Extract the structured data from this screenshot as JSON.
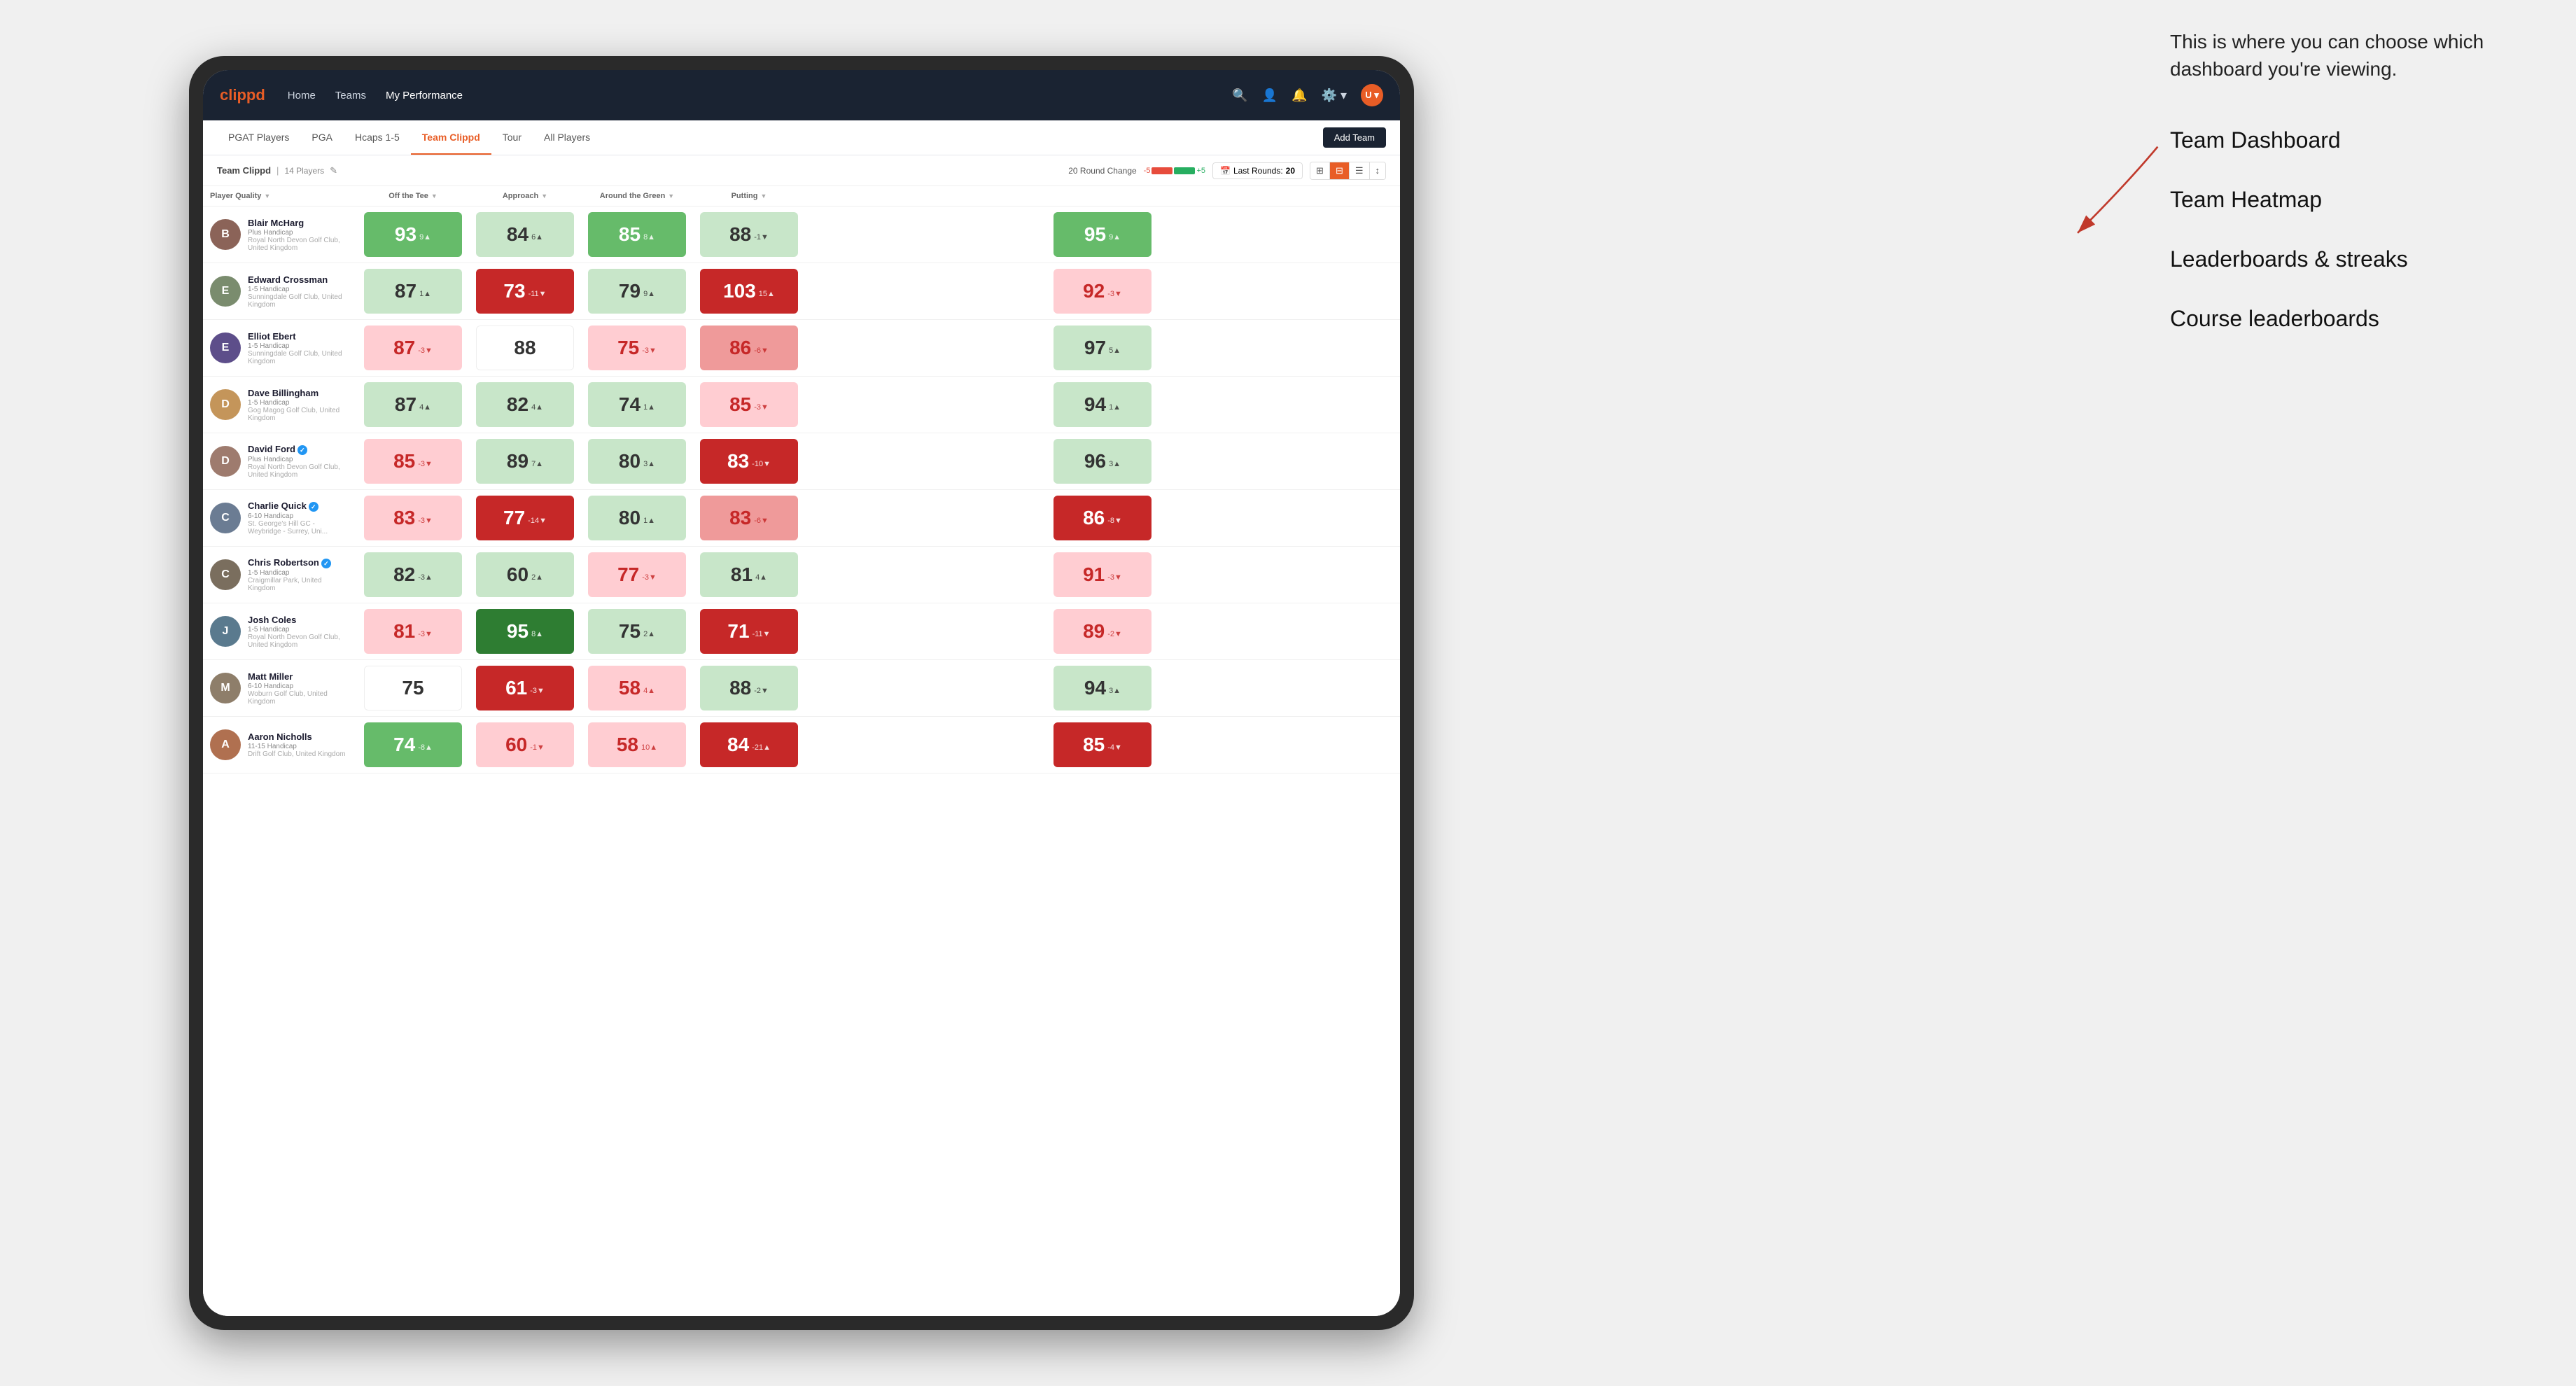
{
  "annotation": {
    "intro_text": "This is where you can choose which dashboard you're viewing.",
    "items": [
      "Team Dashboard",
      "Team Heatmap",
      "Leaderboards & streaks",
      "Course leaderboards"
    ]
  },
  "nav": {
    "logo": "clippd",
    "links": [
      {
        "label": "Home",
        "active": false
      },
      {
        "label": "Teams",
        "active": false
      },
      {
        "label": "My Performance",
        "active": true
      }
    ],
    "icons": [
      "search",
      "user",
      "bell",
      "settings",
      "avatar"
    ]
  },
  "tabs": [
    {
      "label": "PGAT Players",
      "active": false
    },
    {
      "label": "PGA",
      "active": false
    },
    {
      "label": "Hcaps 1-5",
      "active": false
    },
    {
      "label": "Team Clippd",
      "active": true
    },
    {
      "label": "Tour",
      "active": false
    },
    {
      "label": "All Players",
      "active": false
    }
  ],
  "add_team_label": "Add Team",
  "sub_header": {
    "team_name": "Team Clippd",
    "player_count": "14 Players",
    "round_change_label": "20 Round Change",
    "neg_value": "-5",
    "pos_value": "+5",
    "last_rounds_label": "Last Rounds:",
    "last_rounds_value": "20"
  },
  "table": {
    "columns": [
      {
        "key": "player",
        "label": "Player Quality"
      },
      {
        "key": "off_tee",
        "label": "Off the Tee"
      },
      {
        "key": "approach",
        "label": "Approach"
      },
      {
        "key": "around_green",
        "label": "Around the Green"
      },
      {
        "key": "putting",
        "label": "Putting"
      }
    ],
    "players": [
      {
        "name": "Blair McHarg",
        "handicap": "Plus Handicap",
        "club": "Royal North Devon Golf Club, United Kingdom",
        "avatar_letter": "B",
        "avatar_color": "#8b6358",
        "scores": [
          {
            "value": "93",
            "change": "9▲",
            "bg": "green-mid"
          },
          {
            "value": "84",
            "change": "6▲",
            "bg": "green-light"
          },
          {
            "value": "85",
            "change": "8▲",
            "bg": "green-mid"
          },
          {
            "value": "88",
            "change": "-1▼",
            "bg": "green-light"
          },
          {
            "value": "95",
            "change": "9▲",
            "bg": "green-mid"
          }
        ]
      },
      {
        "name": "Edward Crossman",
        "handicap": "1-5 Handicap",
        "club": "Sunningdale Golf Club, United Kingdom",
        "avatar_letter": "E",
        "avatar_color": "#7a8c6e",
        "scores": [
          {
            "value": "87",
            "change": "1▲",
            "bg": "green-light"
          },
          {
            "value": "73",
            "change": "-11▼",
            "bg": "red-dark"
          },
          {
            "value": "79",
            "change": "9▲",
            "bg": "green-light"
          },
          {
            "value": "103",
            "change": "15▲",
            "bg": "red-dark"
          },
          {
            "value": "92",
            "change": "-3▼",
            "bg": "red-light"
          }
        ]
      },
      {
        "name": "Elliot Ebert",
        "handicap": "1-5 Handicap",
        "club": "Sunningdale Golf Club, United Kingdom",
        "avatar_letter": "E",
        "avatar_color": "#5d4e8a",
        "scores": [
          {
            "value": "87",
            "change": "-3▼",
            "bg": "red-light"
          },
          {
            "value": "88",
            "change": "",
            "bg": "white"
          },
          {
            "value": "75",
            "change": "-3▼",
            "bg": "red-light"
          },
          {
            "value": "86",
            "change": "-6▼",
            "bg": "red-mid"
          },
          {
            "value": "97",
            "change": "5▲",
            "bg": "green-light"
          }
        ]
      },
      {
        "name": "Dave Billingham",
        "handicap": "1-5 Handicap",
        "club": "Gog Magog Golf Club, United Kingdom",
        "avatar_letter": "D",
        "avatar_color": "#c4955a",
        "scores": [
          {
            "value": "87",
            "change": "4▲",
            "bg": "green-light"
          },
          {
            "value": "82",
            "change": "4▲",
            "bg": "green-light"
          },
          {
            "value": "74",
            "change": "1▲",
            "bg": "green-light"
          },
          {
            "value": "85",
            "change": "-3▼",
            "bg": "red-light"
          },
          {
            "value": "94",
            "change": "1▲",
            "bg": "green-light"
          }
        ]
      },
      {
        "name": "David Ford",
        "handicap": "Plus Handicap",
        "club": "Royal North Devon Golf Club, United Kingdom",
        "avatar_letter": "D",
        "avatar_color": "#9e7b6e",
        "verified": true,
        "scores": [
          {
            "value": "85",
            "change": "-3▼",
            "bg": "red-light"
          },
          {
            "value": "89",
            "change": "7▲",
            "bg": "green-light"
          },
          {
            "value": "80",
            "change": "3▲",
            "bg": "green-light"
          },
          {
            "value": "83",
            "change": "-10▼",
            "bg": "red-dark"
          },
          {
            "value": "96",
            "change": "3▲",
            "bg": "green-light"
          }
        ]
      },
      {
        "name": "Charlie Quick",
        "handicap": "6-10 Handicap",
        "club": "St. George's Hill GC - Weybridge - Surrey, Uni...",
        "avatar_letter": "C",
        "avatar_color": "#6b7c93",
        "verified": true,
        "scores": [
          {
            "value": "83",
            "change": "-3▼",
            "bg": "red-light"
          },
          {
            "value": "77",
            "change": "-14▼",
            "bg": "red-dark"
          },
          {
            "value": "80",
            "change": "1▲",
            "bg": "green-light"
          },
          {
            "value": "83",
            "change": "-6▼",
            "bg": "red-mid"
          },
          {
            "value": "86",
            "change": "-8▼",
            "bg": "red-dark"
          }
        ]
      },
      {
        "name": "Chris Robertson",
        "handicap": "1-5 Handicap",
        "club": "Craigmillar Park, United Kingdom",
        "avatar_letter": "C",
        "avatar_color": "#7a6e5e",
        "verified": true,
        "scores": [
          {
            "value": "82",
            "change": "-3▲",
            "bg": "green-light"
          },
          {
            "value": "60",
            "change": "2▲",
            "bg": "green-light"
          },
          {
            "value": "77",
            "change": "-3▼",
            "bg": "red-light"
          },
          {
            "value": "81",
            "change": "4▲",
            "bg": "green-light"
          },
          {
            "value": "91",
            "change": "-3▼",
            "bg": "red-light"
          }
        ]
      },
      {
        "name": "Josh Coles",
        "handicap": "1-5 Handicap",
        "club": "Royal North Devon Golf Club, United Kingdom",
        "avatar_letter": "J",
        "avatar_color": "#5a7a8e",
        "scores": [
          {
            "value": "81",
            "change": "-3▼",
            "bg": "red-light"
          },
          {
            "value": "95",
            "change": "8▲",
            "bg": "green-dark"
          },
          {
            "value": "75",
            "change": "2▲",
            "bg": "green-light"
          },
          {
            "value": "71",
            "change": "-11▼",
            "bg": "red-dark"
          },
          {
            "value": "89",
            "change": "-2▼",
            "bg": "red-light"
          }
        ]
      },
      {
        "name": "Matt Miller",
        "handicap": "6-10 Handicap",
        "club": "Woburn Golf Club, United Kingdom",
        "avatar_letter": "M",
        "avatar_color": "#8e7e6a",
        "scores": [
          {
            "value": "75",
            "change": "",
            "bg": "white"
          },
          {
            "value": "61",
            "change": "-3▼",
            "bg": "red-dark"
          },
          {
            "value": "58",
            "change": "4▲",
            "bg": "red-light"
          },
          {
            "value": "88",
            "change": "-2▼",
            "bg": "green-light"
          },
          {
            "value": "94",
            "change": "3▲",
            "bg": "green-light"
          }
        ]
      },
      {
        "name": "Aaron Nicholls",
        "handicap": "11-15 Handicap",
        "club": "Drift Golf Club, United Kingdom",
        "avatar_letter": "A",
        "avatar_color": "#b07050",
        "scores": [
          {
            "value": "74",
            "change": "-8▲",
            "bg": "green-mid"
          },
          {
            "value": "60",
            "change": "-1▼",
            "bg": "red-light"
          },
          {
            "value": "58",
            "change": "10▲",
            "bg": "red-light"
          },
          {
            "value": "84",
            "change": "-21▲",
            "bg": "red-dark"
          },
          {
            "value": "85",
            "change": "-4▼",
            "bg": "red-dark"
          }
        ]
      }
    ]
  }
}
